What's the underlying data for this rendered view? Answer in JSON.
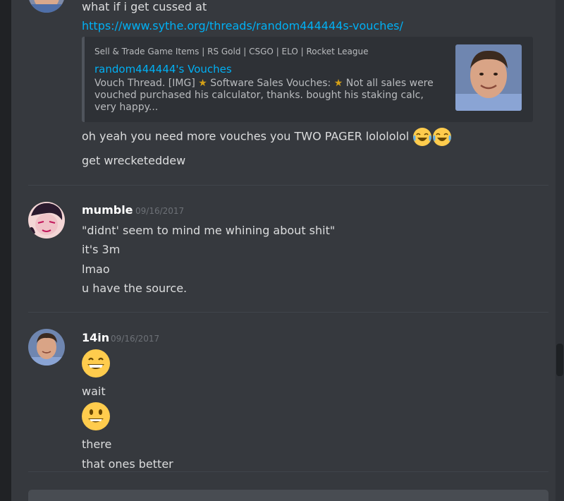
{
  "messages": {
    "top": {
      "line1": "what if i get cussed at",
      "link": "https://www.sythe.org/threads/random444444s-vouches/",
      "embed": {
        "provider": "Sell & Trade Game Items | RS Gold | CSGO | ELO | Rocket League",
        "title": "random444444's Vouches",
        "desc_part1": "Vouch Thread. [IMG] ",
        "desc_part2": " Software Sales Vouches: ",
        "desc_part3": "  Not all sales were vouched purchased his calculator, thanks. bought his staking calc, very happy..."
      },
      "line2": "oh yeah you need more vouches you TWO PAGER lolololol",
      "line3": "get wrecketeddew"
    },
    "mumble": {
      "username": "mumble",
      "timestamp": "09/16/2017",
      "lines": [
        "\"didnt' seem to mind me whining about shit\"",
        "it's 3m",
        "lmao",
        "u have the source."
      ]
    },
    "fourteen_in": {
      "username": "14in",
      "timestamp": "09/16/2017",
      "lines": [
        "wait",
        "there",
        "that ones better"
      ]
    }
  },
  "icons": {
    "emoji_laugh": "face-with-tears-of-joy",
    "emoji_grin": "grinning-face-with-smiling-eyes",
    "emoji_smile": "smiling-face",
    "star": "star"
  },
  "colors": {
    "background": "#36393e",
    "link": "#00b0f4",
    "embed_bg": "#2e3136",
    "username": "#ffffff",
    "timestamp": "#6d7177"
  }
}
